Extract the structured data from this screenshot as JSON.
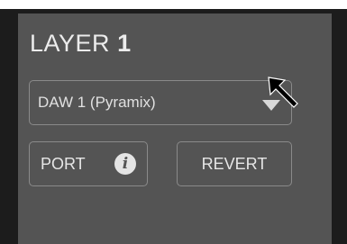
{
  "layer": {
    "prefix": "LAYER",
    "number": "1"
  },
  "source_select": {
    "value": "DAW 1 (Pyramix)"
  },
  "port_button": {
    "label": "PORT"
  },
  "revert_button": {
    "label": "REVERT"
  },
  "icons": {
    "info": "info-icon",
    "dropdown": "chevron-down-icon",
    "cursor": "arrow-cursor-icon"
  },
  "colors": {
    "panel": "#545454",
    "background": "#1c1c1c",
    "text": "#ececec",
    "border": "#8a8a8a"
  }
}
